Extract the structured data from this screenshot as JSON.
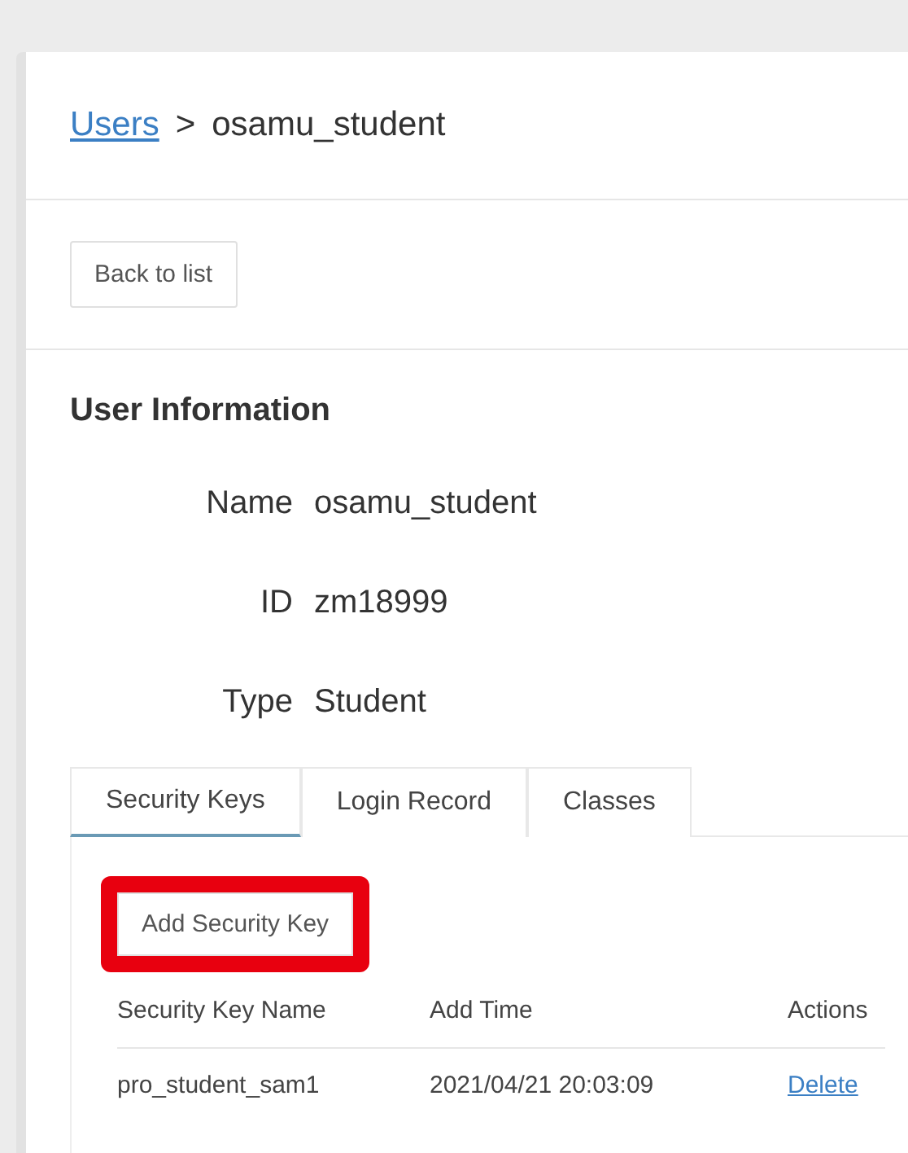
{
  "breadcrumb": {
    "link": "Users",
    "separator": ">",
    "current": "osamu_student"
  },
  "back_button": "Back to list",
  "section_title": "User Information",
  "fields": [
    {
      "label": "Name",
      "value": "osamu_student"
    },
    {
      "label": "ID",
      "value": "zm18999"
    },
    {
      "label": "Type",
      "value": "Student"
    }
  ],
  "tabs": [
    {
      "label": "Security Keys",
      "selected": true
    },
    {
      "label": "Login Record",
      "selected": false
    },
    {
      "label": "Classes",
      "selected": false
    }
  ],
  "add_button": {
    "label": "Add Security Key",
    "highlighted": true
  },
  "table": {
    "columns": [
      "Security Key Name",
      "Add Time",
      "Actions"
    ],
    "rows": [
      {
        "name": "pro_student_sam1",
        "time": "2021/04/21 20:03:09",
        "action": "Delete"
      }
    ]
  }
}
